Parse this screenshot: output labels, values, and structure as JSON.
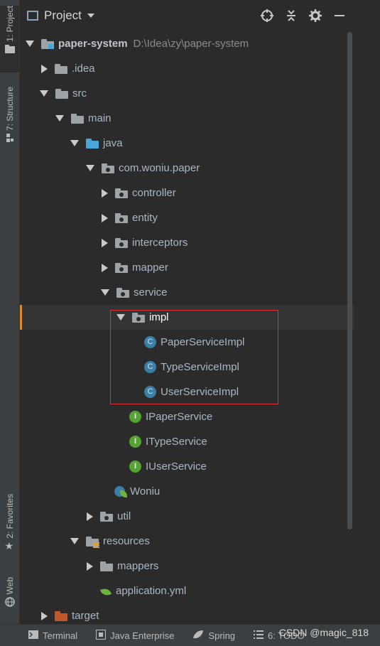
{
  "sidebar": {
    "project_tab": "1: Project",
    "structure_tab": "7: Structure",
    "favorites_tab": "2: Favorites",
    "web_tab": "Web"
  },
  "toolbar": {
    "title": "Project"
  },
  "tree": {
    "root_name": "paper-system",
    "root_path": "D:\\Idea\\zy\\paper-system",
    "idea": ".idea",
    "src": "src",
    "main": "main",
    "java": "java",
    "package": "com.woniu.paper",
    "controller": "controller",
    "entity": "entity",
    "interceptors": "interceptors",
    "mapper": "mapper",
    "service": "service",
    "impl": "impl",
    "impl_classes": [
      "PaperServiceImpl",
      "TypeServiceImpl",
      "UserServiceImpl"
    ],
    "interfaces": [
      "IPaperService",
      "ITypeService",
      "IUserService"
    ],
    "woniu": "Woniu",
    "util": "util",
    "resources": "resources",
    "mappers": "mappers",
    "application_yml": "application.yml",
    "target": "target"
  },
  "icons": {
    "class_glyph": "C",
    "interface_glyph": "I"
  },
  "statusbar": {
    "terminal": "Terminal",
    "java_enterprise": "Java Enterprise",
    "spring": "Spring",
    "todo": "6: TODO"
  },
  "watermark": "CSDN @magic_818",
  "colors": {
    "background": "#2b2b2b",
    "selection_accent": "#d78b2d",
    "highlight_border": "#e0322c",
    "class_icon": "#3a7fa8",
    "interface_icon": "#55a332",
    "target_folder": "#c0592a"
  }
}
